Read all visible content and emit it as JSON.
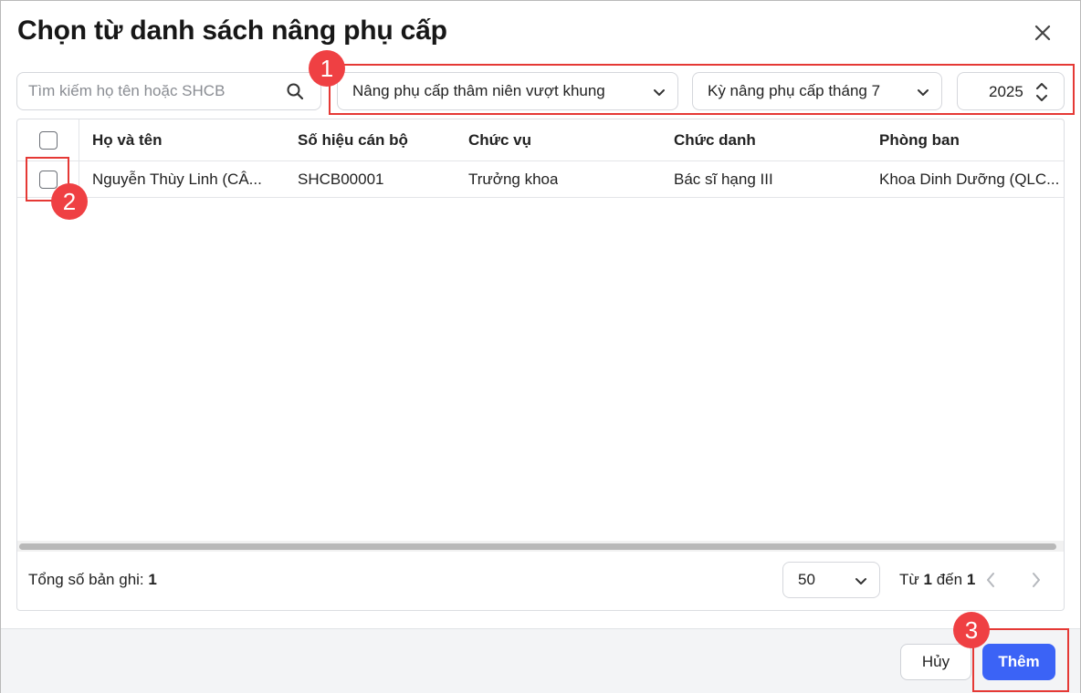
{
  "dialog": {
    "title": "Chọn từ danh sách nâng phụ cấp"
  },
  "filters": {
    "search_placeholder": "Tìm kiếm họ tên hoặc SHCB",
    "allowance_type": "Nâng phụ cấp thâm niên vượt khung",
    "period": "Kỳ nâng phụ cấp tháng 7",
    "year": "2025"
  },
  "table": {
    "columns": [
      "Họ và tên",
      "Số hiệu cán bộ",
      "Chức vụ",
      "Chức danh",
      "Phòng ban"
    ],
    "rows": [
      {
        "name": "Nguyễn Thùy Linh (CÂ...",
        "code": "SHCB00001",
        "position": "Trưởng khoa",
        "title": "Bác sĩ hạng III",
        "department": "Khoa Dinh Dưỡng (QLC..."
      }
    ]
  },
  "pagination": {
    "total_label": "Tổng số bản ghi:",
    "total_value": "1",
    "page_size": "50",
    "from_label": "Từ",
    "from_value": "1",
    "to_label": "đến",
    "to_value": "1"
  },
  "actions": {
    "cancel": "Hủy",
    "add": "Thêm"
  },
  "annotations": {
    "step1": "1",
    "step2": "2",
    "step3": "3"
  },
  "colors": {
    "primary": "#3b63f6",
    "annotation_red": "#e53935"
  }
}
